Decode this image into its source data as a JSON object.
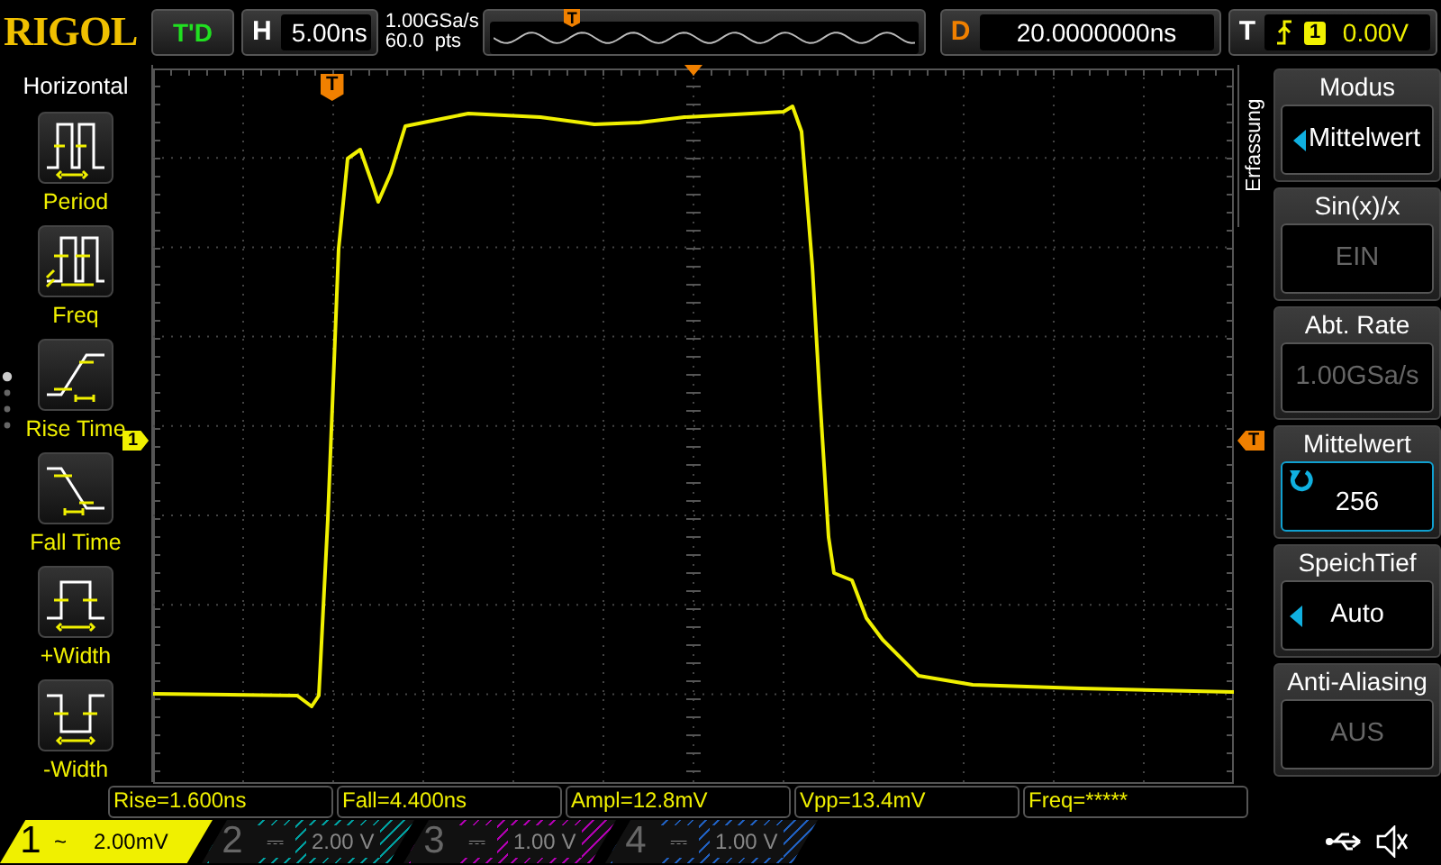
{
  "brand": "RIGOL",
  "run_state": "T'D",
  "timebase": {
    "label": "H",
    "value": "5.00ns"
  },
  "sample_rate": "1.00GSa/s",
  "memory_depth": "60.0  pts",
  "overview_marker": "T",
  "delay": {
    "label": "D",
    "value": "20.0000000ns"
  },
  "trigger": {
    "label": "T",
    "channel": "1",
    "level": "0.00V"
  },
  "left_menu": {
    "title": "Horizontal",
    "items": [
      {
        "label": "Period",
        "kind": "period"
      },
      {
        "label": "Freq",
        "kind": "freq"
      },
      {
        "label": "Rise Time",
        "kind": "rise"
      },
      {
        "label": "Fall Time",
        "kind": "fall"
      },
      {
        "label": "+Width",
        "kind": "pwidth"
      },
      {
        "label": "-Width",
        "kind": "nwidth"
      }
    ]
  },
  "grid_markers": {
    "trigger_position": "T",
    "channel": "1",
    "trigger_level": "T"
  },
  "right_menu": {
    "tab": "Erfassung",
    "items": [
      {
        "title": "Modus",
        "value": "Mittelwert",
        "kind": "select",
        "disabled": false,
        "selected": false
      },
      {
        "title": "Sin(x)/x",
        "value": "EIN",
        "kind": "plain",
        "disabled": true,
        "selected": false
      },
      {
        "title": "Abt. Rate",
        "value": "1.00GSa/s",
        "kind": "plain",
        "disabled": true,
        "selected": false
      },
      {
        "title": "Mittelwert",
        "value": "256",
        "kind": "knob",
        "disabled": false,
        "selected": true
      },
      {
        "title": "SpeichTief",
        "value": "Auto",
        "kind": "select",
        "disabled": false,
        "selected": false
      },
      {
        "title": "Anti-Aliasing",
        "value": "AUS",
        "kind": "plain",
        "disabled": true,
        "selected": false
      }
    ]
  },
  "measurements": [
    "Rise=1.600ns",
    "Fall=4.400ns",
    "Ampl=12.8mV",
    "Vpp=13.4mV",
    "Freq=*****"
  ],
  "channels": [
    {
      "number": "1",
      "coupling": "~",
      "scale": "2.00mV",
      "on": true,
      "color": "#f0f000"
    },
    {
      "number": "2",
      "coupling": "⎓",
      "scale": "2.00 V",
      "on": false,
      "color": "#00a0a0"
    },
    {
      "number": "3",
      "coupling": "⎓",
      "scale": "1.00 V",
      "on": false,
      "color": "#b000b0"
    },
    {
      "number": "4",
      "coupling": "⎓",
      "scale": "1.00 V",
      "on": false,
      "color": "#2060c0"
    }
  ]
}
